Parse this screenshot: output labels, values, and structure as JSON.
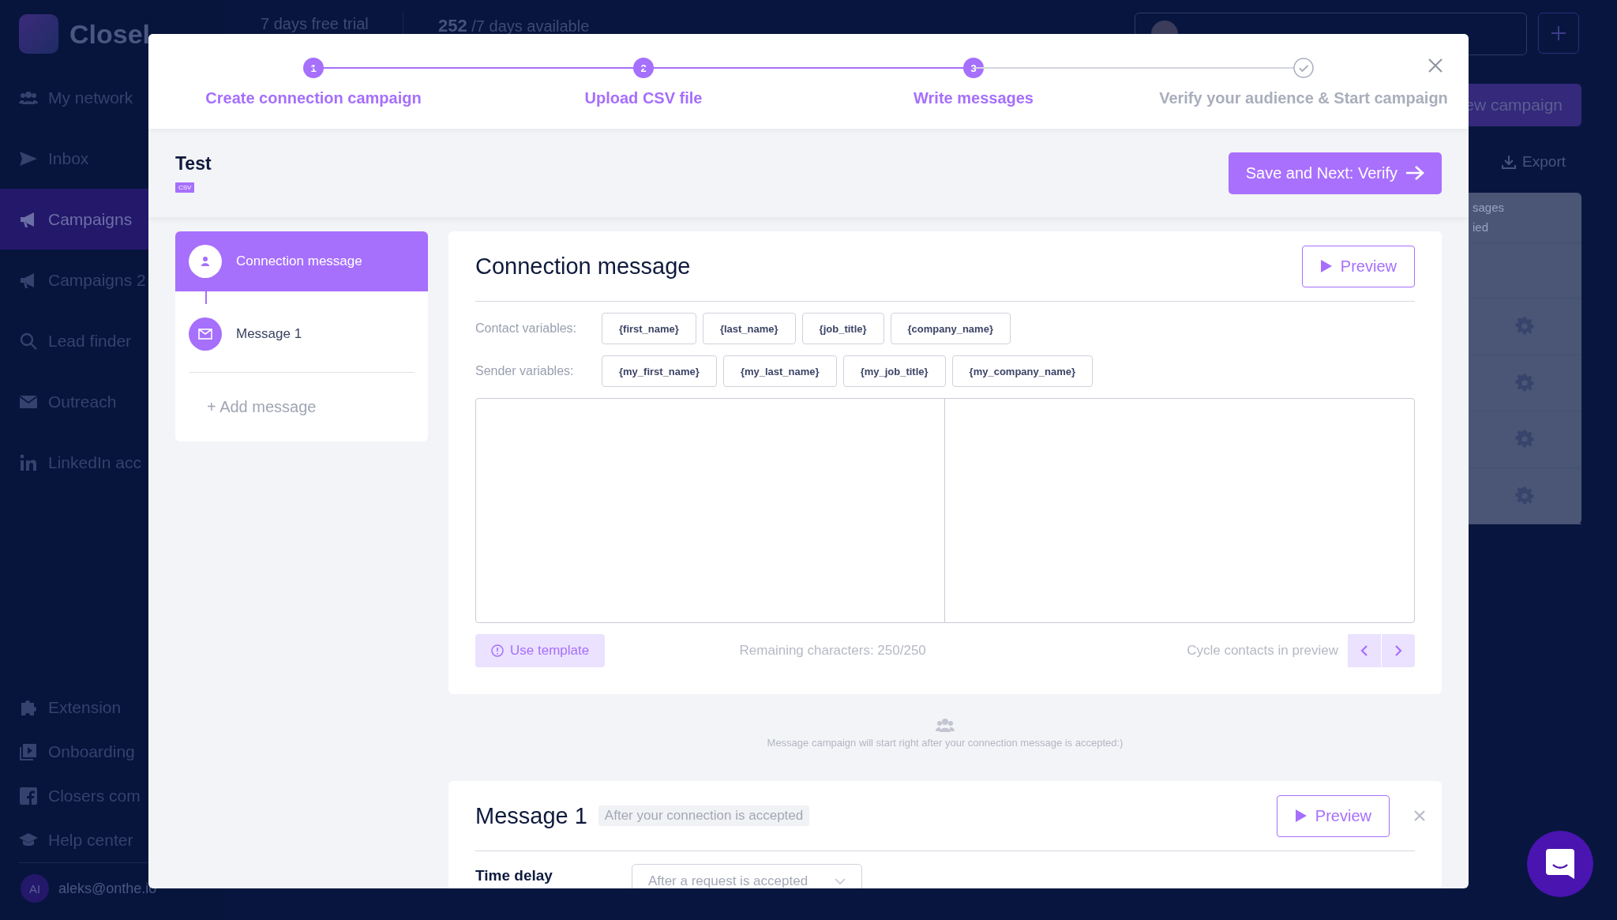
{
  "sidebar": {
    "logo": "Closel",
    "items": [
      {
        "label": "My network",
        "selected": false
      },
      {
        "label": "Inbox",
        "selected": false
      },
      {
        "label": "Campaigns",
        "selected": true
      },
      {
        "label": "Campaigns 2",
        "selected": false
      },
      {
        "label": "Lead finder",
        "selected": false
      },
      {
        "label": "Outreach",
        "selected": false
      },
      {
        "label": "LinkedIn acc",
        "selected": false
      }
    ],
    "footer_items": [
      {
        "label": "Extension"
      },
      {
        "label": "Onboarding"
      },
      {
        "label": "Closers com"
      },
      {
        "label": "Help center"
      }
    ],
    "user": {
      "initials": "AI",
      "email": "aleks@onthe.io"
    }
  },
  "topbar": {
    "trial": "7 days free trial",
    "days_count": "252",
    "days_text": "/7 days available"
  },
  "background_panel": {
    "new_campaign_button": "ew campaign",
    "export_button": "Export",
    "table_header": [
      "sages",
      "ied"
    ]
  },
  "modal": {
    "steps": [
      {
        "number": "1",
        "label": "Create connection campaign",
        "completed": true
      },
      {
        "number": "2",
        "label": "Upload CSV file",
        "completed": true
      },
      {
        "number": "3",
        "label": "Write messages",
        "completed": true
      },
      {
        "label": "Verify your audience & Start campaign",
        "completed": false
      }
    ],
    "campaign_name": "Test",
    "file_badge": "CSV",
    "save_button": "Save and Next: Verify",
    "messages_list": [
      {
        "label": "Connection message",
        "kind": "connection",
        "selected": true
      },
      {
        "label": "Message 1",
        "kind": "message",
        "selected": false
      }
    ],
    "add_message": "+ Add message",
    "connection_message": {
      "title": "Connection message",
      "preview_button": "Preview",
      "contact_variables": {
        "label": "Contact variables:",
        "chips": [
          "{first_name}",
          "{last_name}",
          "{job_title}",
          "{company_name}"
        ]
      },
      "sender_variables": {
        "label": "Sender variables:",
        "chips": [
          "{my_first_name}",
          "{my_last_name}",
          "{my_job_title}",
          "{my_company_name}"
        ]
      },
      "use_template_button": "Use template",
      "remaining": "Remaining characters: 250/250",
      "cycle_label": "Cycle contacts in preview"
    },
    "note": "Message campaign will start right after your connection message is accepted:)",
    "message_1": {
      "title": "Message 1",
      "tag": "After your connection is accepted",
      "preview_button": "Preview",
      "time_delay_label": "Time delay",
      "time_delay_value": "After a request is accepted"
    }
  }
}
